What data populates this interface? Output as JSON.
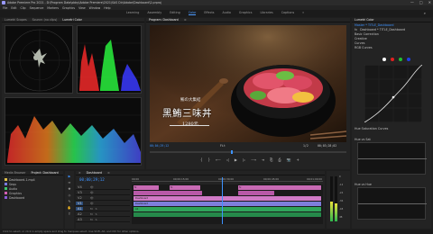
{
  "app": {
    "title": "Adobe Premiere Pro 2021 - D:\\Program Data\\obby\\Adobe Premiere\\2021\\SAS Dir\\Adobe\\Dashboard\\2.prproj"
  },
  "window_controls": {
    "minimize": "—",
    "maximize": "□",
    "close": "✕"
  },
  "menu": [
    "File",
    "Edit",
    "Clip",
    "Sequence",
    "Markers",
    "Graphics",
    "View",
    "Window",
    "Help"
  ],
  "workspaces": {
    "items": [
      "Learning",
      "Assembly",
      "Editing",
      "Color",
      "Effects",
      "Audio",
      "Graphics",
      "Libraries",
      "Captions"
    ],
    "active_index": 3,
    "more": "»"
  },
  "scopes": {
    "tabs": [
      "Lumetri Scopes",
      "Source: (no clips)",
      "Lumetri Color"
    ],
    "active_tab": 0,
    "colors": {
      "vector": "#c8d0c0",
      "red": "#ff2a2a",
      "green": "#2aff40",
      "blue": "#3a3aff"
    }
  },
  "program": {
    "tab": "Program: Dashboard",
    "menu_icon": "≡",
    "title_cn": "黑鮪三味丼",
    "subtitle_cn": "鮪の大集結",
    "price": "1280元",
    "tc_left": "00;04;29;12",
    "tc_right": "00;03;28;02",
    "fit": "Fit",
    "ratio": "1/2",
    "controls": [
      "{",
      "}",
      "⟵",
      "◁",
      "▶",
      "▷",
      "⟶",
      "⇥",
      "⎘",
      "⎙",
      "📷",
      "+"
    ]
  },
  "lumetri": {
    "tab": "Lumetri Color",
    "tab2": "Lumetri Scopes",
    "source": "Master * TITLE_Dashboard",
    "source2": "Dashboard * TITLE_Dashboard",
    "fx": "fx",
    "sections": [
      "Basic Correction",
      "Creative",
      "Curves",
      "RGB Curves"
    ],
    "huesat": "Hue Saturation Curves",
    "hue_vs_sat": "Hue vs Sat",
    "hue_vs_hue": "Hue vs Hue",
    "accent": "#3d92ff"
  },
  "project": {
    "tabs": [
      "Media Browser",
      "Project: Dashboard",
      "Effects"
    ],
    "active_tab": 1,
    "items": [
      {
        "name": "Dashboard-1.mp4",
        "color": "#e0c14a"
      },
      {
        "name": "Sequ",
        "color": "#7a7adf"
      },
      {
        "name": "Audio",
        "color": "#3cc46a"
      },
      {
        "name": "Graphics",
        "color": "#d25fb3"
      },
      {
        "name": "Dashboard",
        "color": "#8a5ad8"
      }
    ]
  },
  "tools": [
    "▶",
    "⇔",
    "✥",
    "◇",
    "✎",
    "✋",
    "T"
  ],
  "timeline": {
    "tab": "Dashboard",
    "close": "×",
    "menu": "≡",
    "tc": "00;00;29;12",
    "ruler": [
      "00;00",
      "00;00;15;00",
      "00;00;30;00",
      "00;00;45;00",
      "00;01;00;00"
    ],
    "video_tracks": [
      "V4",
      "V3",
      "V2",
      "V1"
    ],
    "audio_tracks": [
      "A1",
      "A2",
      "A3"
    ],
    "track_icons": [
      "🔒",
      "👁",
      "M",
      "S",
      "🎤"
    ],
    "clip_label_fx": "fx",
    "clip_label_dash": "Dashboard",
    "clip_label_a": "A1"
  },
  "meters": {
    "scale": [
      "0",
      "-12",
      "-24",
      "-36",
      "-48",
      "dB"
    ]
  },
  "status_bar": "Click to select, or click in empty space and drag to marquee select. Use Shift, Alt, and Ctrl for other options."
}
